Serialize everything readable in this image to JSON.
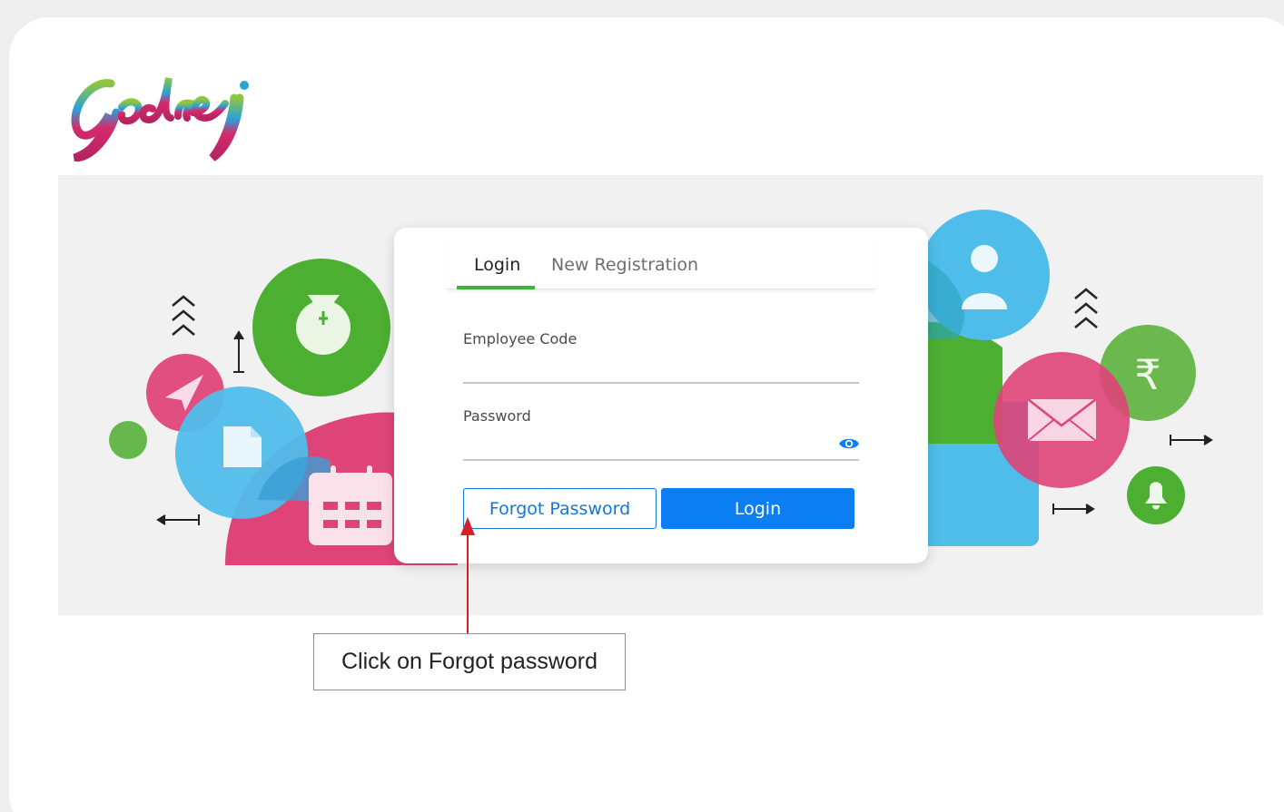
{
  "brand": {
    "logo_text": "Godrej",
    "colors": {
      "green": "#6bb33a",
      "blue": "#2aa1d8",
      "magenta": "#d52a6e",
      "purple": "#6a2b7a"
    }
  },
  "tabs": [
    {
      "label": "Login",
      "active": true
    },
    {
      "label": "New Registration",
      "active": false
    }
  ],
  "form": {
    "employee_code_label": "Employee Code",
    "employee_code_value": "",
    "password_label": "Password",
    "password_value": "",
    "show_password_icon": "eye-icon"
  },
  "buttons": {
    "forgot_password": "Forgot Password",
    "login": "Login"
  },
  "callout": {
    "text": "Click on Forgot password",
    "arrow_color": "#d62027"
  },
  "colors": {
    "primary_blue": "#0a7ef2",
    "tab_accent_green": "#3db23d",
    "illustration_green": "#4caf32",
    "illustration_blue": "#4fbdea",
    "illustration_pink": "#e0457b"
  }
}
